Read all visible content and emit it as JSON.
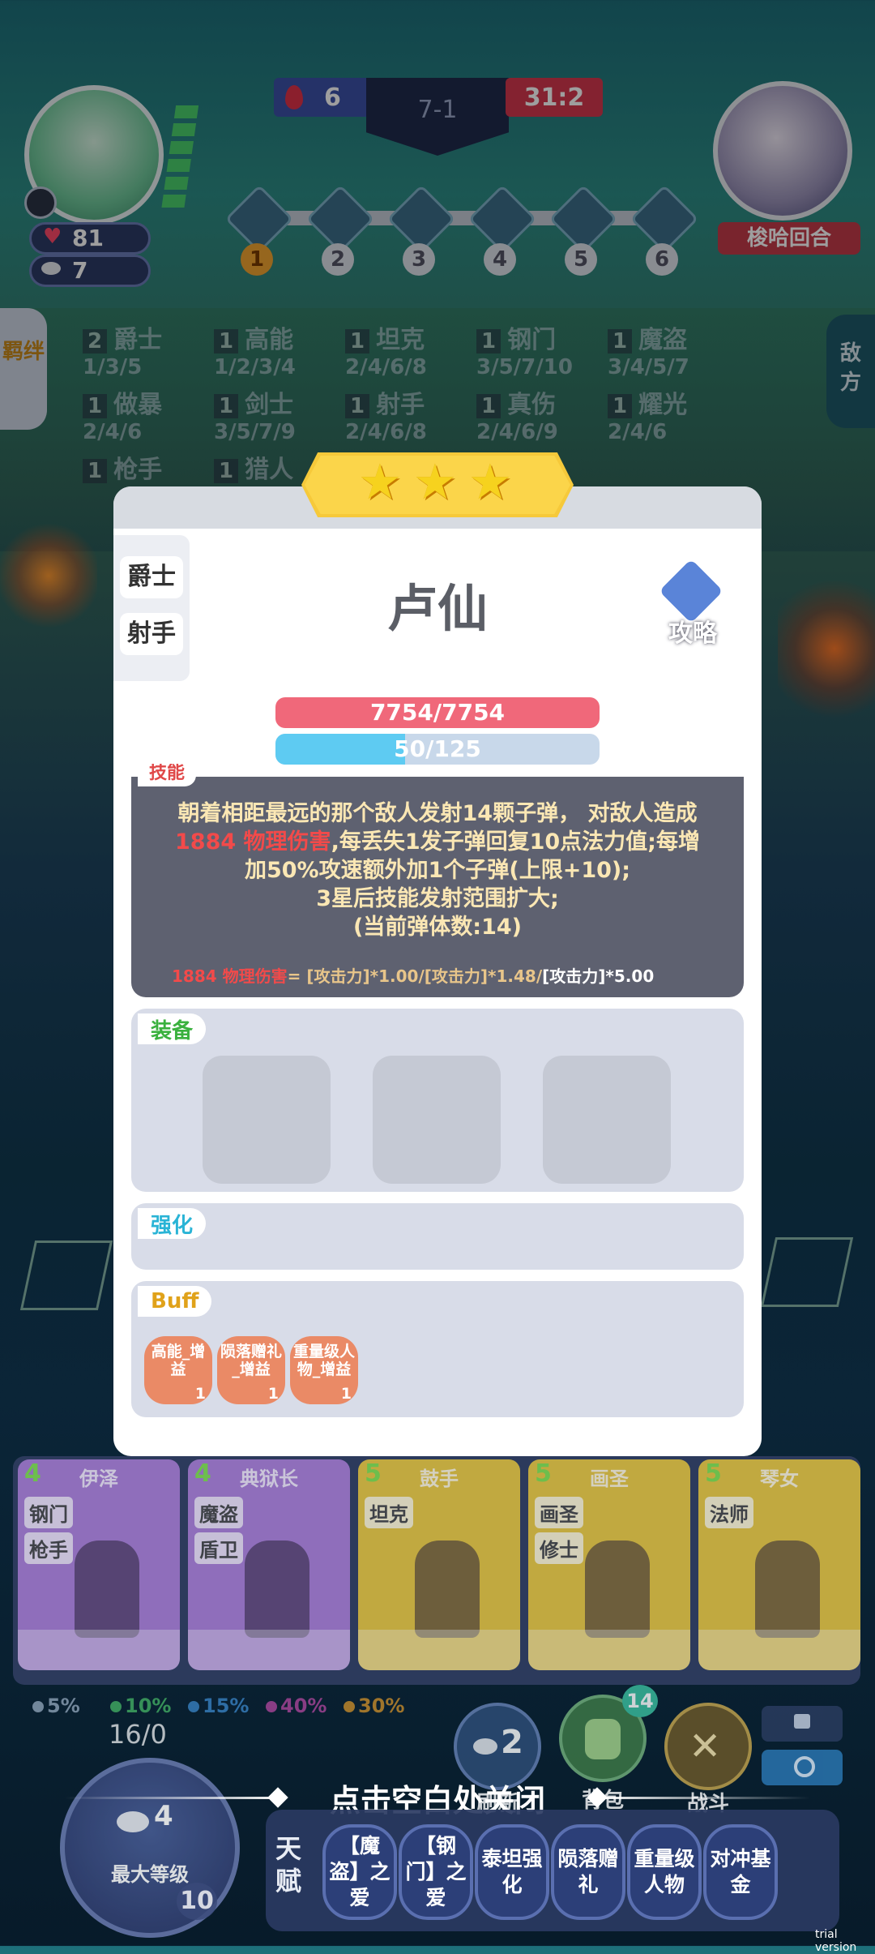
{
  "hud": {
    "player_hp": "81",
    "player_coins": "7",
    "score_left": "6",
    "stage": "7-1",
    "score_right": "31:2",
    "opponent_label": "梭哈回合",
    "rounds": [
      "1",
      "2",
      "3",
      "4",
      "5",
      "6"
    ]
  },
  "side_tabs": {
    "left": "羁绊",
    "right": "敌方"
  },
  "synergies": [
    {
      "count": "2",
      "name": "爵士",
      "levels": "1/3/5"
    },
    {
      "count": "1",
      "name": "高能",
      "levels": "1/2/3/4"
    },
    {
      "count": "1",
      "name": "坦克",
      "levels": "2/4/6/8"
    },
    {
      "count": "1",
      "name": "钢门",
      "levels": "3/5/7/10"
    },
    {
      "count": "1",
      "name": "魔盗",
      "levels": "3/4/5/7"
    },
    {
      "count": "1",
      "name": "做暴",
      "levels": "2/4/6"
    },
    {
      "count": "1",
      "name": "剑士",
      "levels": "3/5/7/9"
    },
    {
      "count": "1",
      "name": "射手",
      "levels": "2/4/6/8"
    },
    {
      "count": "1",
      "name": "真伤",
      "levels": "2/4/6/9"
    },
    {
      "count": "1",
      "name": "耀光",
      "levels": "2/4/6"
    },
    {
      "count": "1",
      "name": "枪手",
      "levels": ""
    },
    {
      "count": "1",
      "name": "猎人",
      "levels": ""
    }
  ],
  "unit": {
    "stars": 3,
    "name": "卢仙",
    "traits": [
      "爵士",
      "射手"
    ],
    "guide_label": "攻略",
    "hp_text": "7754/7754",
    "mana_text": "50/125",
    "mana_fraction": 0.4,
    "skill_tag": "技能",
    "skill_line1": "朝着相距最远的那个敌人发射14颗子弹， 对敌人造成",
    "skill_dmg": "1884 物理伤害",
    "skill_line2": ",每丢失1发子弹回复10点法力值;每增",
    "skill_line3": "加50%攻速额外加1个子弹(上限+10);",
    "skill_line4": "3星后技能发射范围扩大;",
    "skill_line5": "(当前弹体数:14)",
    "formula_dmg": "1884 物理伤害",
    "formula_a": "= [攻击力]*1.00/[攻击力]*1.48/",
    "formula_b": "[攻击力]*5.00"
  },
  "sections": {
    "equip": "装备",
    "enhance": "强化",
    "buff": "Buff"
  },
  "buffs": [
    {
      "line1": "高能_增",
      "line2": "益",
      "count": "1"
    },
    {
      "line1": "陨落赠礼",
      "line2": "_增益",
      "count": "1"
    },
    {
      "line1": "重量级人",
      "line2": "物_增益",
      "count": "1"
    }
  ],
  "shop": [
    {
      "cost": "4",
      "name": "伊泽",
      "tags": [
        "钢门",
        "枪手"
      ],
      "color": "#a57ad0"
    },
    {
      "cost": "4",
      "name": "典狱长",
      "tags": [
        "魔盗",
        "盾卫"
      ],
      "color": "#a57ad0"
    },
    {
      "cost": "5",
      "name": "鼓手",
      "tags": [
        "坦克"
      ],
      "color": "#e2c23a"
    },
    {
      "cost": "5",
      "name": "画圣",
      "tags": [
        "画圣",
        "修士"
      ],
      "color": "#e2c23a"
    },
    {
      "cost": "5",
      "name": "琴女",
      "tags": [
        "法师"
      ],
      "color": "#e2c23a"
    }
  ],
  "odds": [
    "5%",
    "10%",
    "15%",
    "40%",
    "30%"
  ],
  "level": {
    "xp": "16/0",
    "coins": "4",
    "label": "最大等级",
    "level": "10"
  },
  "buttons": {
    "refresh_cost": "2",
    "refresh": "刷新",
    "bag": "背包",
    "bag_count": "14",
    "fight": "战斗"
  },
  "close_hint": "点击空白处关闭",
  "talent_label": "天赋",
  "talents": [
    "【魔盗】之爱",
    "【钢门】之爱",
    "泰坦强化",
    "陨落赠礼",
    "重量级人物",
    "对冲基金"
  ],
  "watermark": "trial version",
  "colors": {
    "hp": "#f0687a",
    "mana": "#5ecbf2",
    "mana_bg": "#c8d8ea",
    "damage": "#f24a4a",
    "skill_bg": "#5e6170"
  }
}
